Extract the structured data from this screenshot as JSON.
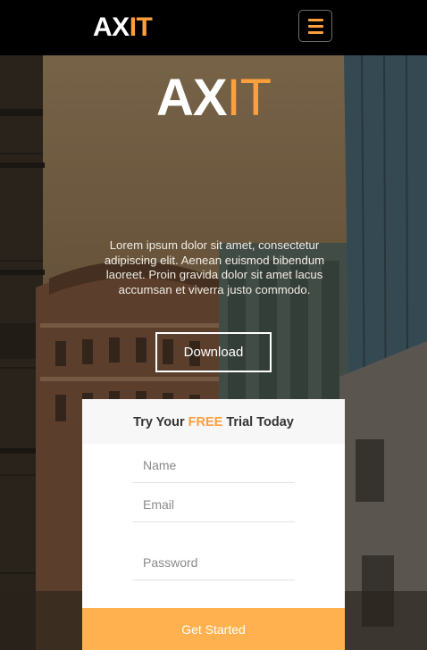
{
  "navbar": {
    "logo_part1": "AX",
    "logo_part2": "IT",
    "menu_icon": "hamburger-menu-icon"
  },
  "hero": {
    "logo_part1": "AX",
    "logo_part2": "IT",
    "description": "Lorem ipsum dolor sit amet, consectetur adipiscing elit. Aenean euismod bibendum laoreet. Proin gravida dolor sit amet lacus accumsan et viverra justo commodo.",
    "download_label": "Download"
  },
  "trial_form": {
    "title_before": "Try Your ",
    "title_highlight": "FREE",
    "title_after": " Trial Today",
    "name_placeholder": "Name",
    "email_placeholder": "Email",
    "password_placeholder": "Password",
    "submit_label": "Get Started"
  },
  "colors": {
    "accent": "#ff9e3d",
    "button_accent": "#ffb14f",
    "navbar_bg": "#000000"
  }
}
